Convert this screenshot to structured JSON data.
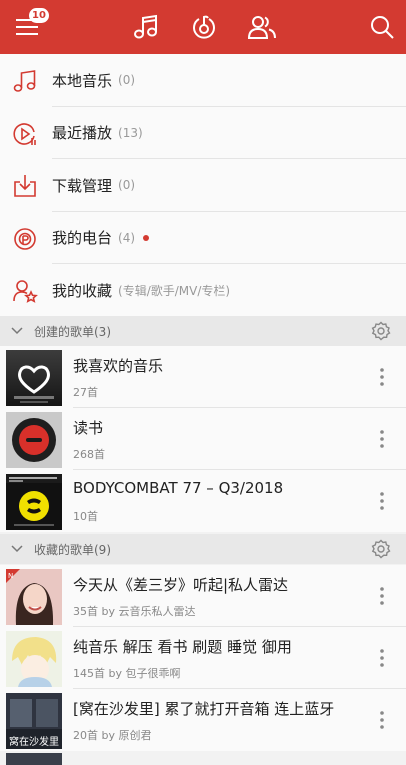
{
  "topbar": {
    "menu_badge": "10",
    "icons": [
      "menu-icon",
      "music-note-icon",
      "netease-disc-icon",
      "friends-icon",
      "search-icon"
    ]
  },
  "menu": [
    {
      "icon": "music-note-icon",
      "label": "本地音乐",
      "count": "(0)"
    },
    {
      "icon": "recent-play-icon",
      "label": "最近播放",
      "count": "(13)"
    },
    {
      "icon": "download-icon",
      "label": "下载管理",
      "count": "(0)"
    },
    {
      "icon": "radio-icon",
      "label": "我的电台",
      "count": "(4)"
    },
    {
      "icon": "collection-icon",
      "label": "我的收藏",
      "count": "(专辑/歌手/MV/专栏)"
    }
  ],
  "created_section": {
    "title": "创建的歌单(3)"
  },
  "collected_section": {
    "title": "收藏的歌单(9)"
  },
  "created_playlists": [
    {
      "title": "我喜欢的音乐",
      "sub": "27首",
      "cover_text": "SPOTIFY"
    },
    {
      "title": "读书",
      "sub": "268首"
    },
    {
      "title": "BODYCOMBAT 77 – Q3/2018",
      "sub": "10首",
      "cover_text": "ALKAINE, LIL' JON & JOYRIDE"
    }
  ],
  "collected_playlists": [
    {
      "title": "今天从《差三岁》听起|私人雷达",
      "sub": "35首 by 云音乐私人雷达"
    },
    {
      "title": "纯音乐 解压 看书 刷题 睡觉 御用",
      "sub": "145首 by 包子很乖啊"
    },
    {
      "title": "[窝在沙发里] 累了就打开音箱 连上蓝牙",
      "sub": "20首 by 原创君",
      "cover_text": "窝在沙发里"
    }
  ],
  "colors": {
    "accent": "#d33a31",
    "background": "#f2f2f2"
  }
}
